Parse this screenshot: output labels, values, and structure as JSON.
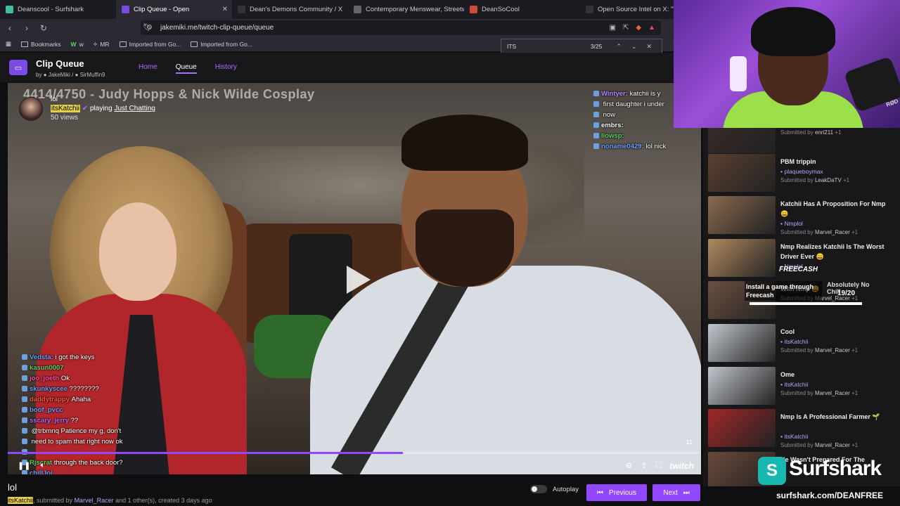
{
  "browser": {
    "tabs": [
      {
        "label": "Deanscool - Surfshark",
        "color": "#3fbf9f",
        "active": false
      },
      {
        "label": "Clip Queue - Open",
        "color": "#7b4ae2",
        "active": true
      },
      {
        "label": "Dean's Demons Community / X",
        "color": "#333",
        "active": false
      },
      {
        "label": "Contemporary Menswear, Streetwea",
        "color": "#666",
        "active": false
      },
      {
        "label": "DeanSoCool",
        "color": "#d04a3a",
        "active": false
      },
      {
        "label": "Open Source Intel on X: \"WILD",
        "color": "#333",
        "active": false
      }
    ],
    "url": "jakemiki.me/twitch-clip-queue/queue",
    "bookmarks": [
      "Bookmarks",
      "w",
      "MR",
      "Imported from Go...",
      "Imported from Go..."
    ],
    "find": {
      "query": "ITS",
      "count": "3/25"
    }
  },
  "clipqueue": {
    "title": "Clip Queue",
    "by_label": "by",
    "authors": [
      "JakeMiki",
      "SirMuffin9"
    ],
    "nav": [
      "Home",
      "Queue",
      "History"
    ]
  },
  "video": {
    "overlay_title": "4414/4750 - Judy Hopps & Nick Wilde Cosplay",
    "clip_title": "lol",
    "streamer": "itsKatchii",
    "playing_label": "playing",
    "game": "Just Chatting",
    "views": "50 views",
    "count_label": "11",
    "progress": 0.57,
    "brand": "twitch"
  },
  "chat_top": [
    {
      "user": "Wintyer:",
      "color": "#b58bff",
      "msg": "katchii is y"
    },
    {
      "user": "",
      "color": "#fff",
      "msg": "first daughter i under"
    },
    {
      "user": "",
      "color": "#fff",
      "msg": "now"
    },
    {
      "user": "embrs:",
      "color": "#ffffff",
      "msg": ""
    },
    {
      "user": "llowsp:",
      "color": "#5fd35f",
      "msg": ""
    },
    {
      "user": "noname0429:",
      "color": "#6aa0ff",
      "msg": "lol nick"
    }
  ],
  "chat_bottom": [
    {
      "user": "Vedsta:",
      "color": "#6aa0ff",
      "msg": "i got the keys"
    },
    {
      "user": "kasun0007",
      "color": "#5fd35f",
      "msg": ""
    },
    {
      "user": "joo_joeth",
      "color": "#ff4aa0",
      "msg": "Ok"
    },
    {
      "user": "skunkyscee",
      "color": "#6aa0ff",
      "msg": "????????"
    },
    {
      "user": "daddytrappy",
      "color": "#ff5a3a",
      "msg": "Ahaha"
    },
    {
      "user": "boof_pvcc",
      "color": "#6aa0ff",
      "msg": ""
    },
    {
      "user": "sscary_jerry",
      "color": "#b06aff",
      "msg": "??"
    },
    {
      "user": "",
      "color": "#ff4aa0",
      "msg": "@trbmnq Patience my g, don't"
    },
    {
      "user": "",
      "color": "#fff",
      "msg": "need to spam that right now ok"
    },
    {
      "user": "",
      "color": "#fff",
      "msg": ""
    },
    {
      "user": "Rjscrat",
      "color": "#5fd35f",
      "msg": "through the back door?"
    },
    {
      "user": "chillJoi",
      "color": "#6aa0ff",
      "msg": ""
    }
  ],
  "info": {
    "title": "lol",
    "streamer": "itsKatchii",
    "submitted_by_label": ", submitted by",
    "submitter": "Marvel_Racer",
    "rest": "and 1 other(s), created 3 days ago"
  },
  "controls": {
    "autoplay_label": "Autoplay",
    "previous_label": "Previous",
    "next_label": "Next"
  },
  "queue": [
    {
      "title": "",
      "channel": "",
      "submitter": "enri211",
      "extra": "+1",
      "thumb": "#3a2a2a"
    },
    {
      "title": "PBM trippin",
      "channel": "plaqueboymax",
      "submitter": "LeakDaTV",
      "extra": "+1",
      "thumb": "#5a4030"
    },
    {
      "title": "Katchii Has A Proposition For Nmp 😄",
      "channel": "Nmplol",
      "submitter": "Marvel_Racer",
      "extra": "+1",
      "thumb": "#8a6a50"
    },
    {
      "title": "Nmp Realizes Katchii Is The Worst Driver Ever 😄",
      "channel": "Nmplol",
      "submitter": "",
      "extra": "+1",
      "thumb": "#b08a60"
    },
    {
      "title": "With Nmp 😄",
      "channel": "",
      "submitter": "Marvel_Racer",
      "extra": "+1",
      "thumb": "#6a5040"
    },
    {
      "title": "Cool",
      "channel": "itsKatchii",
      "submitter": "Marvel_Racer",
      "extra": "+1",
      "thumb": "#c2c6cc"
    },
    {
      "title": "Ome",
      "channel": "itsKatchii",
      "submitter": "Marvel_Racer",
      "extra": "+1",
      "thumb": "#c2c6cc"
    },
    {
      "title": "Nmp Is A Professional Farmer 🌱",
      "channel": "itsKatchii",
      "submitter": "Marvel_Racer",
      "extra": "+1",
      "thumb": "#a02828"
    },
    {
      "title": "He Wasn't Prepared For The",
      "channel": "",
      "submitter": "",
      "extra": "",
      "thumb": "#6a4a3a"
    }
  ],
  "queue_labels": {
    "submitted_by": "Submitted by"
  },
  "freecash": {
    "logo": "FREECASH",
    "text": "Install a game through Freecash",
    "overlay_text": "Absolutely No Chill",
    "count": "19/20"
  },
  "surfshark": {
    "word": "Surfshark",
    "url": "surfshark.com/DEANFREE"
  },
  "webcam": {
    "mic_label": "RØD"
  }
}
